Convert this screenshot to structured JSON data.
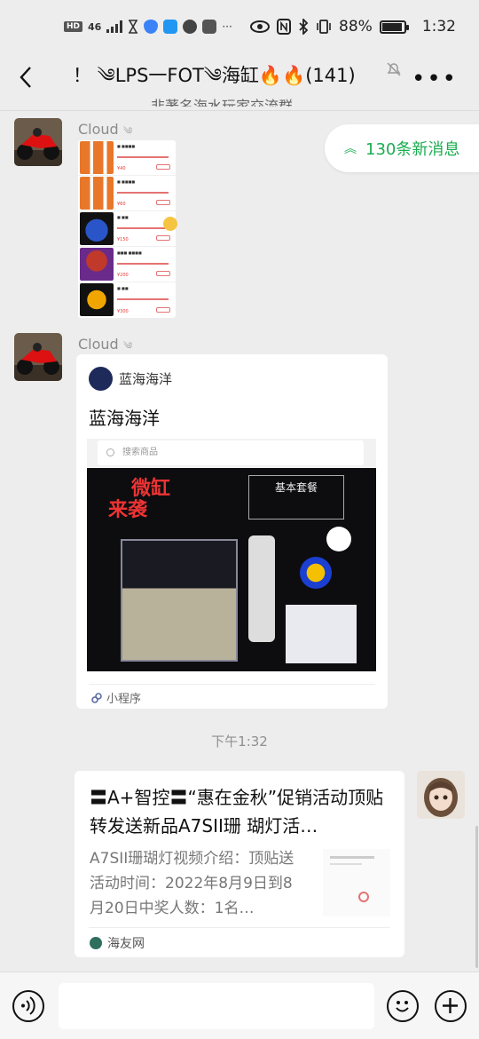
{
  "status_bar": {
    "hd": "HD",
    "signal": "46",
    "battery": "88%",
    "time": "1:32"
  },
  "header": {
    "title": "！ ༄LPS一FOT༄海缸🔥🔥(141)",
    "subtitle": "非著名海水玩家交流群"
  },
  "new_messages": {
    "label": "130条新消息"
  },
  "messages": [
    {
      "sender": "Cloud",
      "type": "image",
      "products": [
        {
          "thumb_color": "#e8772a",
          "price": "¥40"
        },
        {
          "thumb_color": "#e8772a",
          "price": "¥60"
        },
        {
          "thumb_color": "#2a55c8",
          "price": "¥150"
        },
        {
          "thumb_color": "#c0392b",
          "price": "¥200"
        },
        {
          "thumb_color": "#f0a500",
          "price": "¥300"
        }
      ]
    },
    {
      "sender": "Cloud",
      "type": "mini_program",
      "source": "蓝海海洋",
      "title": "蓝海海洋",
      "search_placeholder": "搜索商品",
      "promo_text_1": "微缸",
      "promo_text_2": "来袭",
      "promo_panel": "基本套餐",
      "footer": "小程序"
    }
  ],
  "timestamp": "下午1:32",
  "link_message": {
    "title": "〓A+智控〓“惠在金秋”促销活动顶贴转发送新品A7SII珊 瑚灯活…",
    "description": "A7SII珊瑚灯视频介绍：顶贴送活动时间：2022年8月9日到8月20日中奖人数：1名…",
    "source": "海友网"
  },
  "colors": {
    "accent_green": "#1aad50",
    "background": "#ededed"
  }
}
